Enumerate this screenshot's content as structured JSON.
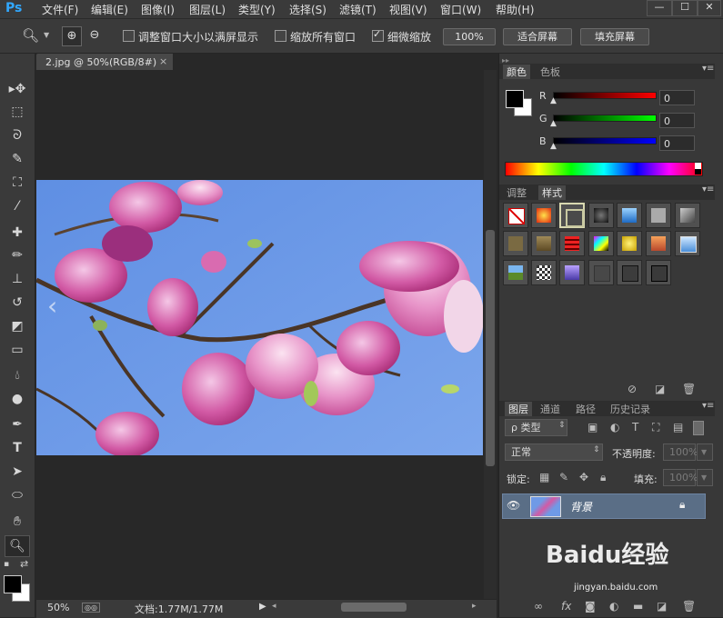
{
  "app": {
    "logo": "Ps"
  },
  "menu": [
    "文件(F)",
    "编辑(E)",
    "图像(I)",
    "图层(L)",
    "类型(Y)",
    "选择(S)",
    "滤镜(T)",
    "视图(V)",
    "窗口(W)",
    "帮助(H)"
  ],
  "window_controls": {
    "minimize": "—",
    "maximize": "☐",
    "close": "✕"
  },
  "options": {
    "resize_windows": {
      "label": "调整窗口大小以满屏显示",
      "checked": false
    },
    "zoom_all": {
      "label": "缩放所有窗口",
      "checked": false
    },
    "scrubby_zoom": {
      "label": "细微缩放",
      "checked": true
    },
    "zoom_100_label": "100%",
    "fit_screen_label": "适合屏幕",
    "fill_screen_label": "填充屏幕"
  },
  "document": {
    "tab_title": "2.jpg @ 50%(RGB/8#)",
    "close": "×"
  },
  "status": {
    "zoom": "50%",
    "doc_info": "文档:1.77M/1.77M"
  },
  "color_panel": {
    "tabs": [
      "颜色",
      "色板"
    ],
    "channels": [
      {
        "label": "R",
        "value": "0"
      },
      {
        "label": "G",
        "value": "0"
      },
      {
        "label": "B",
        "value": "0"
      }
    ]
  },
  "styles_panel": {
    "tabs": [
      "调整",
      "样式"
    ]
  },
  "layers_panel": {
    "tabs": [
      "图层",
      "通道",
      "路径",
      "历史记录"
    ],
    "filter_label": "ρ 类型",
    "blend_mode": "正常",
    "opacity_label": "不透明度:",
    "opacity_value": "100%",
    "lock_label": "锁定:",
    "fill_label": "填充:",
    "fill_value": "100%",
    "layers": [
      {
        "name": "背景",
        "visible": true,
        "locked": true
      }
    ]
  },
  "watermark": {
    "text": "Baidu经验",
    "sub": "jingyan.baidu.com"
  },
  "colors": {
    "accent": "#31a8ff",
    "layer_selected": "#5a6e86",
    "sky": "#6f9ae6"
  }
}
